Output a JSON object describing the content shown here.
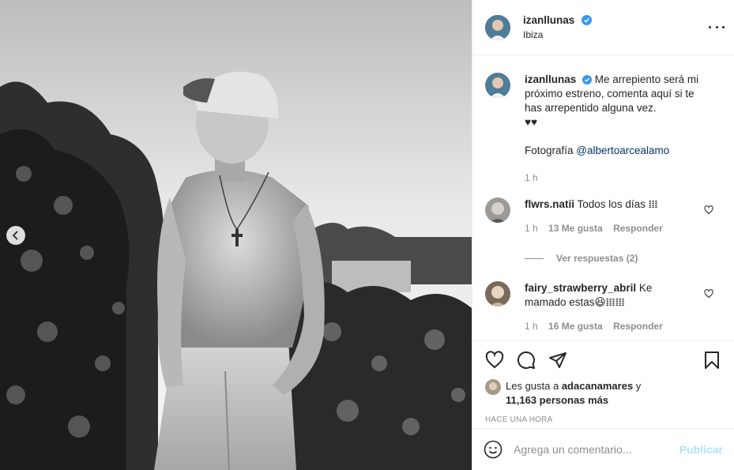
{
  "post": {
    "username": "izanllunas",
    "location": "Ibiza",
    "caption_lines": [
      "Me arrepiento será mi",
      "próximo estreno, comenta aquí si te",
      "has arrepentido alguna vez."
    ],
    "caption_hearts": "♥♥",
    "photo_credit_prefix": "Fotografía ",
    "photo_credit_link": "@albertoarcealamo",
    "caption_age": "1 h"
  },
  "comments": [
    {
      "username": "flwrs.natii",
      "text": "Todos los días 𝍖",
      "age": "1 h",
      "likes": "13 Me gusta",
      "reply": "Responder",
      "view_replies": "Ver respuestas (2)"
    },
    {
      "username": "fairy_strawberry_abril",
      "text_line1": "Ke",
      "text_line2": "mamado estas😆𝍖𝍖",
      "age": "1 h",
      "likes": "16 Me gusta",
      "reply": "Responder"
    }
  ],
  "likes_summary": {
    "prefix": "Les gusta a ",
    "user": "adacanamares",
    "suffix": " y",
    "others": "11,163 personas más"
  },
  "timestamp": "HACE UNA HORA",
  "add_comment": {
    "placeholder": "Agrega un comentario...",
    "publish_label": "Publicar"
  },
  "icons": {
    "nav_prev": "chevron-left-icon",
    "verified": "verified-badge-icon",
    "more": "more-options-icon",
    "like": "heart-icon",
    "comment": "comment-icon",
    "share": "share-icon",
    "save": "bookmark-icon",
    "emoji": "emoji-icon"
  },
  "colors": {
    "verified": "#3897f0",
    "link": "#00376b",
    "muted": "#8e8e8e",
    "publish_disabled": "#b2dffc"
  }
}
